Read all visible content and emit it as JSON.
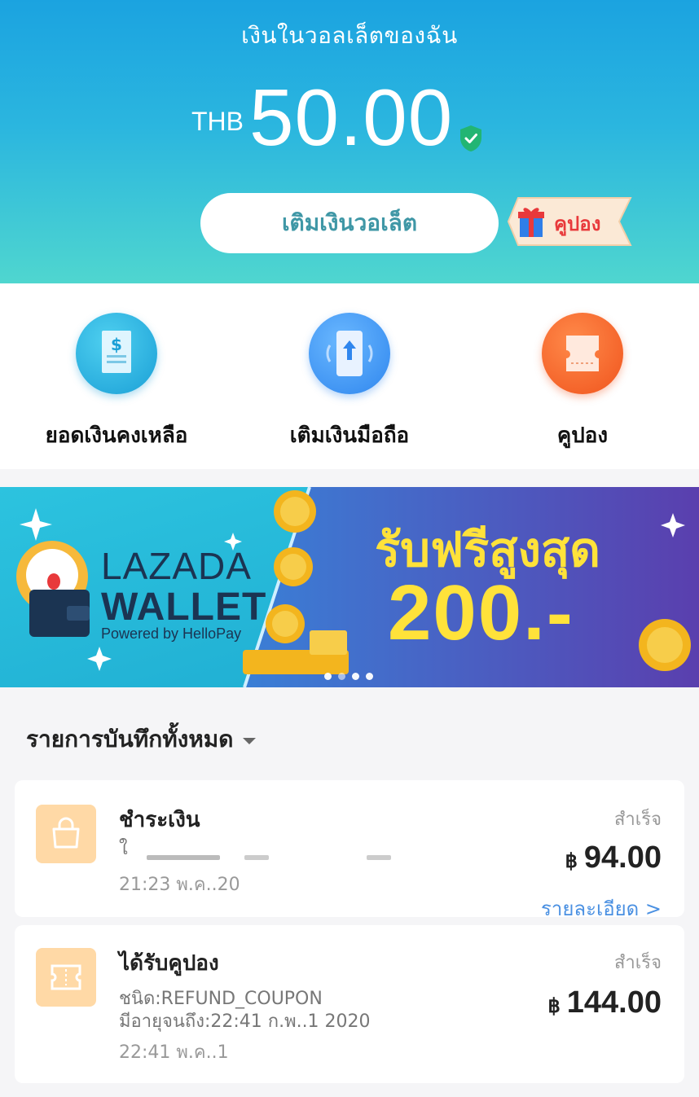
{
  "header": {
    "title": "เงินในวอลเล็ตของฉัน",
    "currency": "THB",
    "balance": "50.00",
    "topup_label": "เติมเงินวอเล็ต",
    "coupon_label": "คูปอง",
    "gradient_top": "#1ba3e0",
    "gradient_bottom": "#4fd6cf"
  },
  "actions": [
    {
      "label": "ยอดเงินคงเหลือ",
      "icon": "balance-document-icon",
      "color": "#1a9fd6"
    },
    {
      "label": "เติมเงินมือถือ",
      "icon": "mobile-topup-icon",
      "color": "#2f86ee"
    },
    {
      "label": "คูปอง",
      "icon": "ticket-icon",
      "color": "#f0541d"
    }
  ],
  "banner": {
    "brand_line1": "LAZADA",
    "brand_line2": "WALLET",
    "brand_line3": "Powered by HelloPay",
    "promo_line1": "รับฟรีสูงสุด",
    "promo_line2": "200.-",
    "slide_count": 4,
    "active_slide": 2
  },
  "records": {
    "filter_label": "รายการบันทึกทั้งหมด",
    "items": [
      {
        "title": "ชำระเงิน",
        "subtitle": "ใ",
        "time": "21:23 พ.ค..20",
        "status": "สำเร็จ",
        "currency_symbol": "฿",
        "amount": "94.00",
        "detail_label": "รายละเอียด >",
        "icon": "shopping-bag-icon"
      },
      {
        "title": "ได้รับคูปอง",
        "subtitle": "ชนิด:REFUND_COUPON",
        "subtitle2": "มีอายุจนถึง:22:41 ก.พ..1 2020",
        "time": "22:41 พ.ค..1",
        "status": "สำเร็จ",
        "currency_symbol": "฿",
        "amount": "144.00",
        "icon": "coupon-ticket-icon"
      }
    ]
  }
}
